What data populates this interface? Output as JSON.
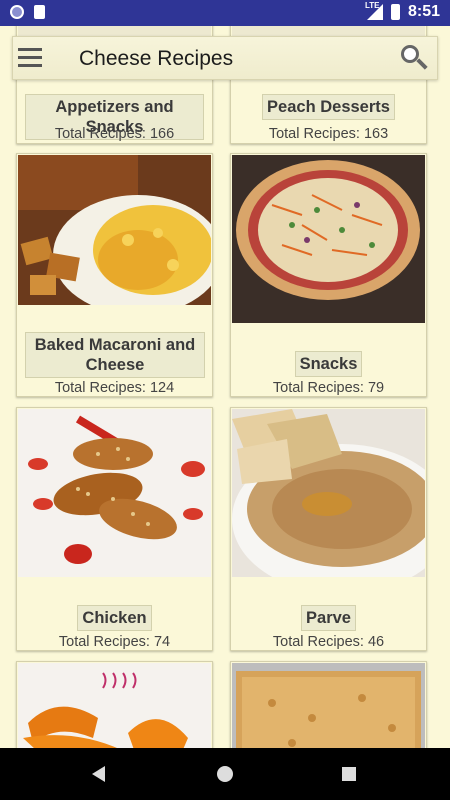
{
  "status_bar": {
    "time": "8:51",
    "network": "LTE"
  },
  "app_bar": {
    "title": "Cheese Recipes"
  },
  "cards": [
    {
      "name": "Appetizers and Snacks",
      "count_text": "Total Recipes: 166"
    },
    {
      "name": "Peach Desserts",
      "count_text": "Total Recipes: 163"
    },
    {
      "name": "Baked Macaroni and Cheese",
      "count_text": "Total Recipes: 124"
    },
    {
      "name": "Snacks",
      "count_text": "Total Recipes: 79"
    },
    {
      "name": "Chicken",
      "count_text": "Total Recipes: 74"
    },
    {
      "name": "Parve",
      "count_text": "Total Recipes: 46"
    }
  ],
  "icons": {
    "menu": "hamburger-menu-icon",
    "search": "search-icon",
    "back": "back-triangle-icon",
    "home": "home-circle-icon",
    "recent": "recent-square-icon"
  },
  "colors": {
    "status_bar": "#2f3596",
    "background": "#fbf8d8",
    "label_bg": "#ecebd0"
  }
}
